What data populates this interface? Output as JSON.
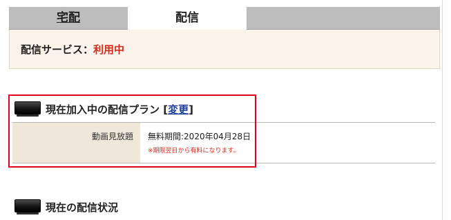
{
  "tabs": {
    "home_delivery": "宅配",
    "streaming": "配信"
  },
  "status": {
    "label": "配信サービス：",
    "value": "利用中",
    "value_color": "#d42b1e"
  },
  "current_plan": {
    "heading": "現在加入中の配信プラン",
    "bracket_open": "[",
    "change_link": "変更",
    "bracket_close": "]",
    "icon": "tv-icon",
    "plan_name": "動画見放題",
    "trial_period": "無料期間:2020年04月28日",
    "notice": "※期限翌日から有料になります。"
  },
  "delivery_status": {
    "heading": "現在の配信状況",
    "icon": "tv-icon"
  },
  "colors": {
    "highlight_border": "#e4001b",
    "link": "#1f3f9b",
    "panel_bg": "#fbf4ea",
    "tab_inactive": "#bdbdbd"
  }
}
